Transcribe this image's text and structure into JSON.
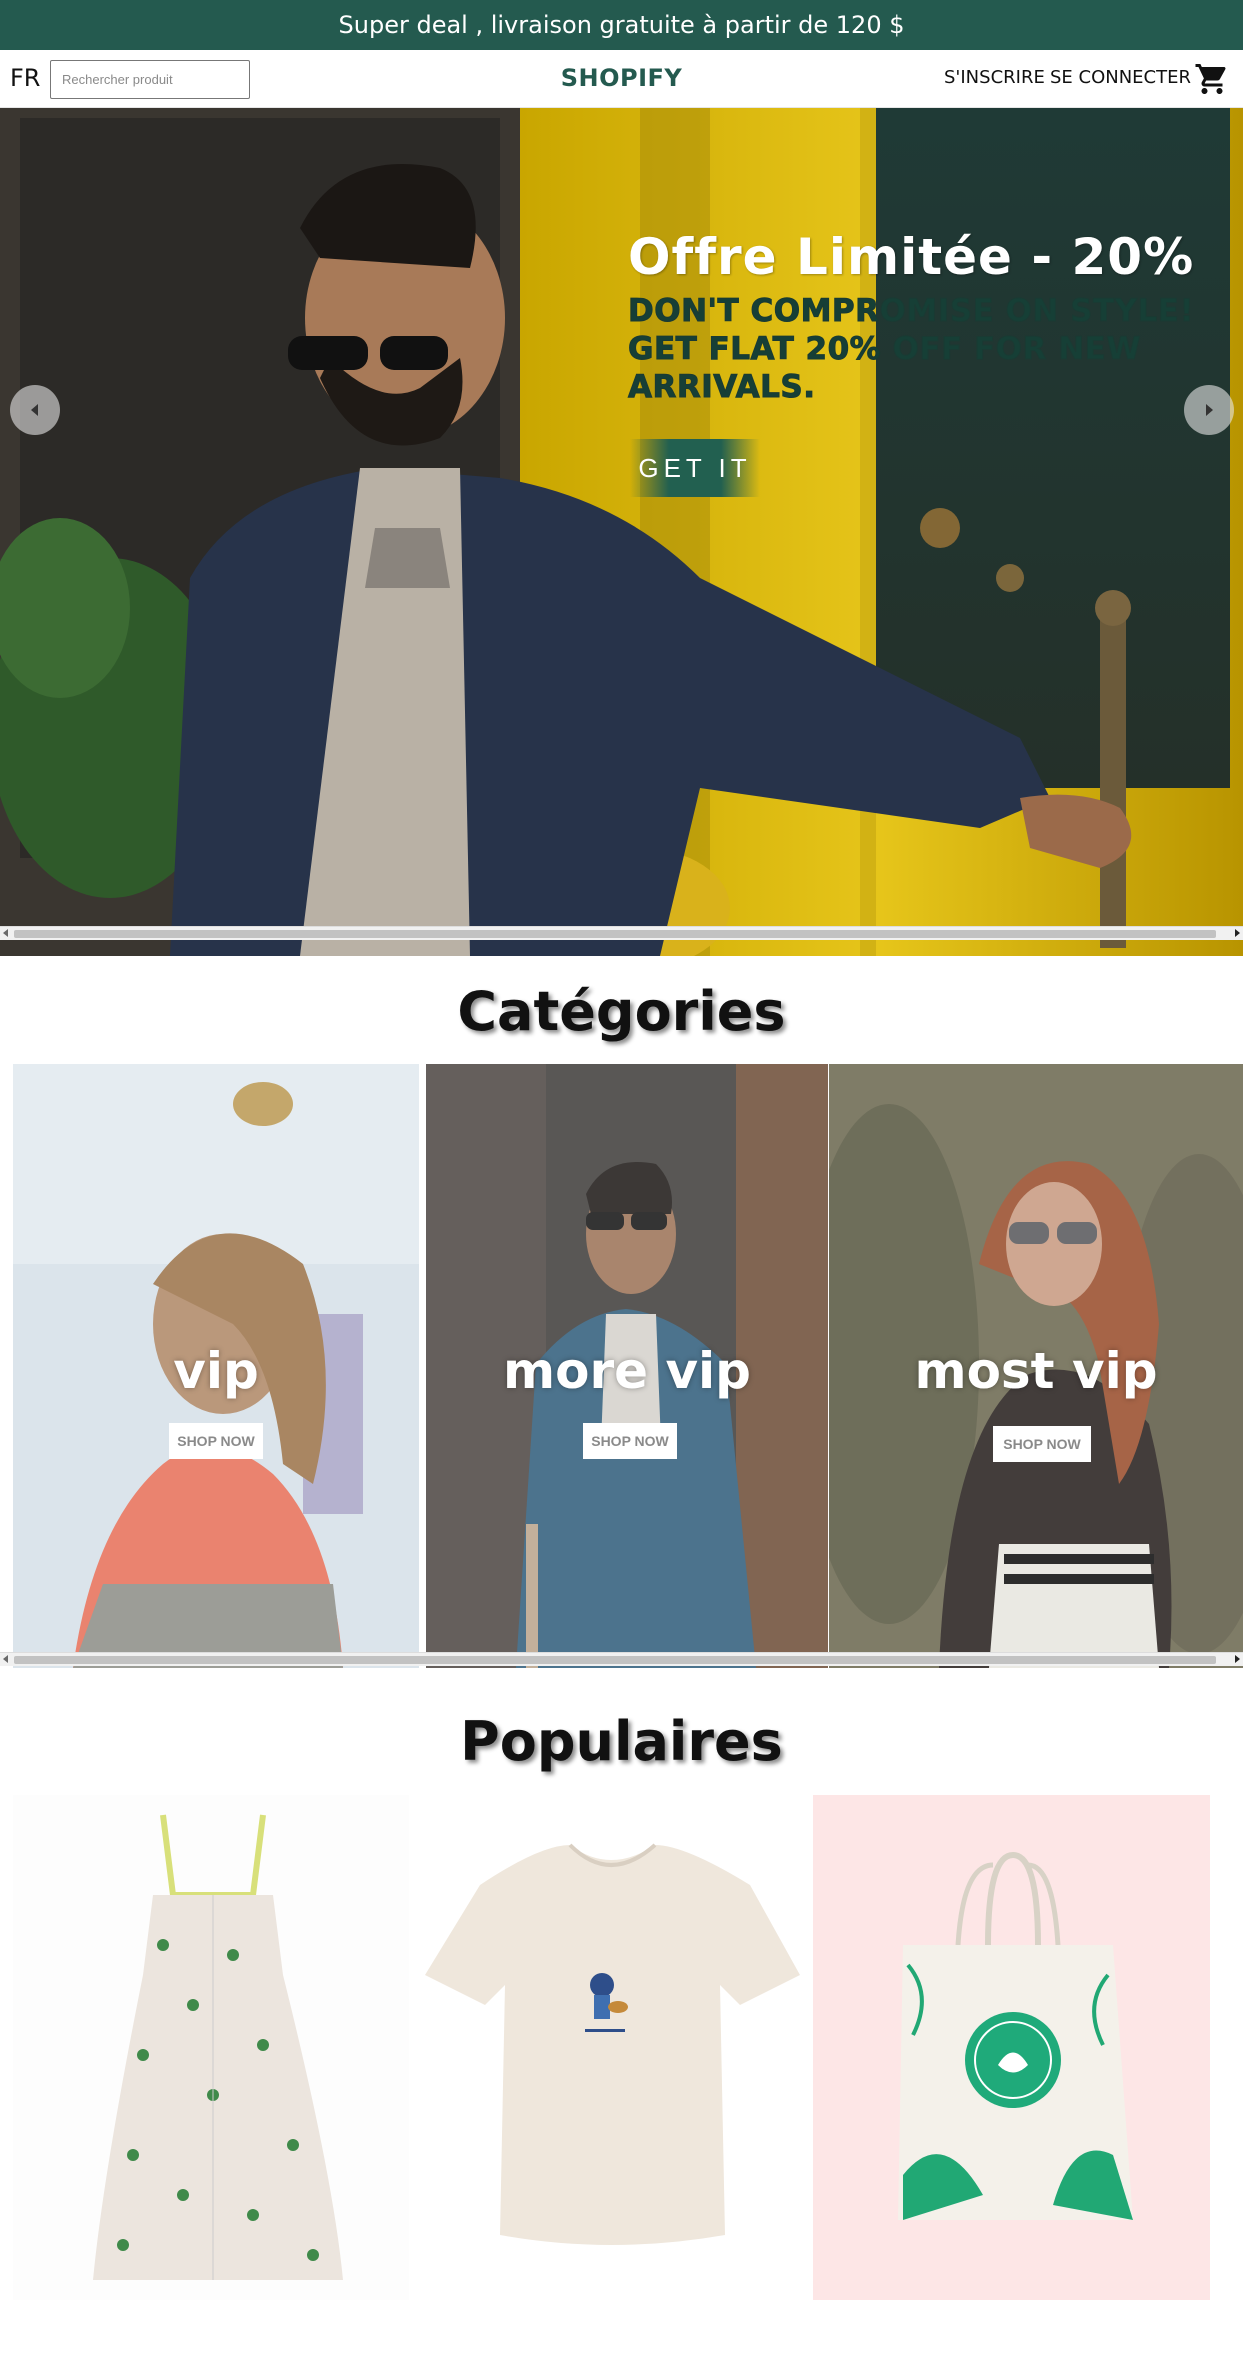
{
  "announcement": {
    "text": "Super deal , livraison gratuite à partir de 120 $"
  },
  "navbar": {
    "language": "FR",
    "search_placeholder": "Rechercher produit",
    "logo": "SHOPIFY",
    "signup_label": "S'INSCRIRE",
    "login_label": "SE CONNECTER",
    "cart_icon": "shopping-cart-icon"
  },
  "slider": {
    "title": "Offre Limitée - 20%",
    "description": "DON'T COMPROMISE ON STYLE! GET FLAT 20% OFF FOR NEW ARRIVALS.",
    "button_label": "GET IT",
    "left_icon": "arrow-left-icon",
    "right_icon": "arrow-right-icon"
  },
  "categories": {
    "heading": "Catégories",
    "items": [
      {
        "label": "vip",
        "button": "SHOP NOW"
      },
      {
        "label": "more vip",
        "button": "SHOP NOW"
      },
      {
        "label": "most vip",
        "button": "SHOP NOW"
      }
    ]
  },
  "popular": {
    "heading": "Populaires",
    "products": [
      {
        "image": "floral-dress"
      },
      {
        "image": "beige-t-shirt"
      },
      {
        "image": "canvas-tote-bag"
      }
    ]
  },
  "colors": {
    "brand": "#245a4f",
    "slide_desc": "#163f36",
    "tote_bg": "#fde6e6"
  }
}
